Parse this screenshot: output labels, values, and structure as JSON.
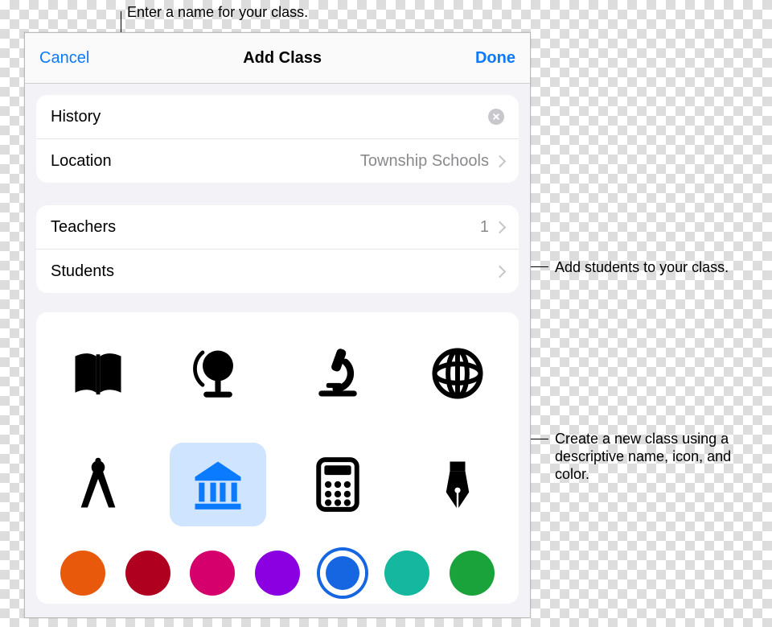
{
  "navbar": {
    "cancel": "Cancel",
    "title": "Add Class",
    "done": "Done"
  },
  "class_name_field": {
    "value": "History"
  },
  "location_row": {
    "label": "Location",
    "value": "Township Schools"
  },
  "teachers_row": {
    "label": "Teachers",
    "count": "1"
  },
  "students_row": {
    "label": "Students"
  },
  "icons": [
    "book",
    "globe-stand",
    "microscope",
    "globe-wire",
    "compass",
    "bank",
    "calculator",
    "pen-nib"
  ],
  "selected_icon_index": 5,
  "colors": [
    "#e8590c",
    "#b00020",
    "#d6006c",
    "#8a00e0",
    "#1566e0",
    "#15b79e",
    "#19a33a"
  ],
  "selected_color_index": 4,
  "callouts": {
    "name": "Enter a name for your class.",
    "students": "Add students to your class.",
    "create": "Create a new class using a descriptive name, icon, and color."
  }
}
